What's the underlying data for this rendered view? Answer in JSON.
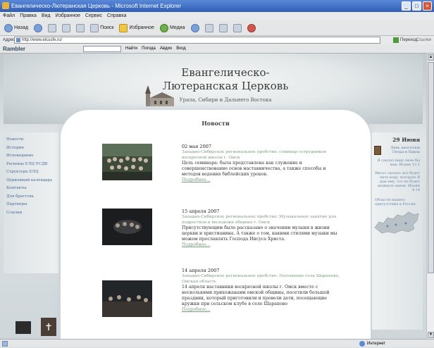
{
  "window": {
    "title": "Евангелическо-Лютеранская Церковь - Microsoft Internet Explorer",
    "controls": [
      "_",
      "□",
      "×"
    ]
  },
  "menu": [
    "Файл",
    "Правка",
    "Вид",
    "Избранное",
    "Сервис",
    "Справка"
  ],
  "toolbar": {
    "back": "Назад",
    "search": "Поиск",
    "favorites": "Избранное",
    "media": "Медиа"
  },
  "address": {
    "label": "Адрес",
    "value": "http://www.elcusfe.ru/",
    "go": "Переход",
    "links": "Ссылки"
  },
  "rambler": {
    "logo": "Rambler",
    "find": "Найти",
    "news": "Погода",
    "auto": "Авдио",
    "mail": "Вход"
  },
  "site": {
    "title": "Евангелическо-Лютеранская Церковь",
    "subtitle": "Урала, Сибири и Дальнего Востока",
    "section": "Новости",
    "nav": [
      "Новости",
      "История",
      "Исповедание",
      "Регионы ЕЛЦ УСДВ",
      "Структура ЕЛЦ",
      "Церковный календарь",
      "Контакты",
      "Для братства",
      "Партнеры",
      "Ссылки"
    ],
    "news": [
      {
        "date": "02 мая 2007",
        "lead": "Западно-Сибирское региональное пробство: семинар сотрудников воскресной школы г. Омск",
        "body": "Цель семинара: была представлена как служение и совершенствование основ наставничества, а также способы и методов ведения библейских уроков.",
        "more": "Подробнее..."
      },
      {
        "date": "15 апреля 2007",
        "lead": "Западно-Сибирское региональное пробство: Музыкальное занятие для подростков и молодежи общины г. Омск",
        "body": "Присутствующим было рассказано о значении музыки в жизни церкви и христианина. А также о том, какими стилями музыки мы можем прославлять Господа Иисуса Христа.",
        "more": "Подробнее..."
      },
      {
        "date": "14 апреля 2007",
        "lead": "Западно-Сибирское региональное пробство: Посещение села Шарапово, Омская область",
        "body": "14 апреля наставники воскресной школы г. Омск вместе с несколькими прихожанами омской общины, посетили большой праздник, который приготовили и провели дети, посещающие кружки при сельском клубе в селе Шарапово",
        "more": "Подробнее..."
      }
    ],
    "right": {
      "date": "29 Июня",
      "feast": "День апостолов Петра и Павла",
      "verse1": "Я сделал веру свою бы вам. Исаия 12:1",
      "verse2": "Иисус сказал: все будет пить воду, которую Я дам ему, тот не будет жаждать вовек. Иоанн 4:14",
      "map_text": "Области нашего присутствия в России"
    }
  },
  "status": {
    "zone": "Интернет"
  },
  "colors": {
    "titlebar": "#2f5fb5",
    "nav_link": "#4d6a96",
    "lead_text": "#7b9a80"
  }
}
